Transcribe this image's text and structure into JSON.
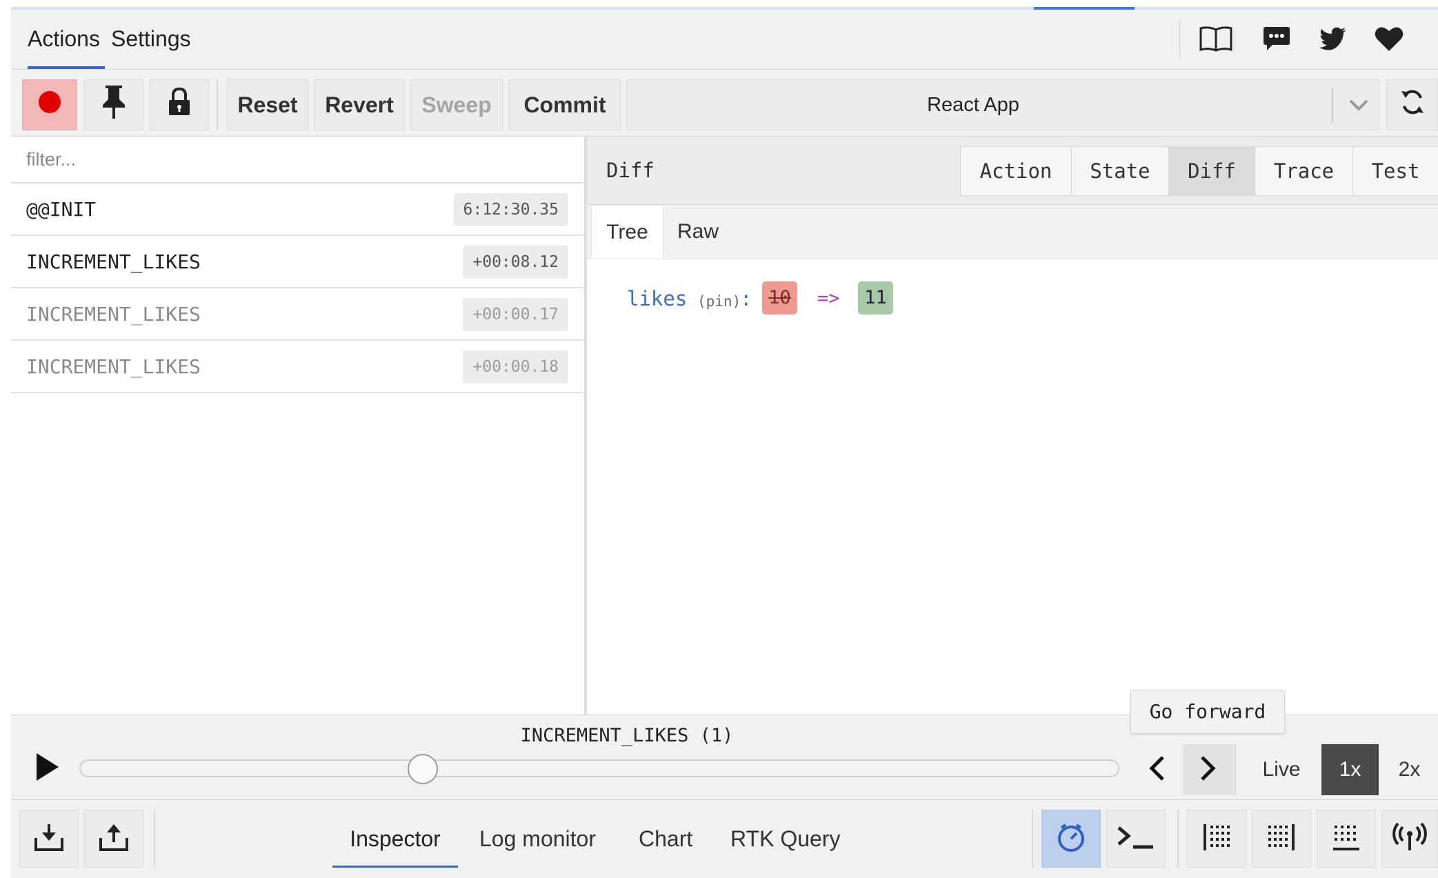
{
  "top_tabs": [
    {
      "label": "Actions",
      "active": true
    },
    {
      "label": "Settings",
      "active": false
    }
  ],
  "header_icons": [
    "book-icon",
    "chat-icon",
    "twitter-icon",
    "heart-icon"
  ],
  "toolbar": {
    "record_icon": "record-icon",
    "pin_icon": "pin-icon",
    "lock_icon": "lock-icon",
    "reset_label": "Reset",
    "revert_label": "Revert",
    "sweep_label": "Sweep",
    "commit_label": "Commit",
    "instance_label": "React App",
    "refresh_icon": "refresh-icon"
  },
  "filter": {
    "placeholder": "filter...",
    "value": ""
  },
  "actions": [
    {
      "name": "@@INIT",
      "time": "6:12:30.35",
      "skipped": false
    },
    {
      "name": "INCREMENT_LIKES",
      "time": "+00:08.12",
      "skipped": false
    },
    {
      "name": "INCREMENT_LIKES",
      "time": "+00:00.17",
      "skipped": true
    },
    {
      "name": "INCREMENT_LIKES",
      "time": "+00:00.18",
      "skipped": true
    }
  ],
  "detail": {
    "title": "Diff",
    "tabs": [
      {
        "label": "Action",
        "active": false
      },
      {
        "label": "State",
        "active": false
      },
      {
        "label": "Diff",
        "active": true
      },
      {
        "label": "Trace",
        "active": false
      },
      {
        "label": "Test",
        "active": false
      }
    ],
    "subtabs": [
      {
        "label": "Tree",
        "active": true
      },
      {
        "label": "Raw",
        "active": false
      }
    ],
    "diff": {
      "key": "likes",
      "pin": "(pin)",
      "colon": ":",
      "old": "10",
      "arrow": "=>",
      "new": "11"
    }
  },
  "slider": {
    "label": "INCREMENT_LIKES (1)",
    "position": 0.33,
    "tooltip": "Go forward",
    "speeds": [
      {
        "label": "Live",
        "active": false
      },
      {
        "label": "1x",
        "active": true
      },
      {
        "label": "2x",
        "active": false
      }
    ]
  },
  "monitors": [
    {
      "label": "Inspector",
      "active": true
    },
    {
      "label": "Log monitor",
      "active": false
    },
    {
      "label": "Chart",
      "active": false
    },
    {
      "label": "RTK Query",
      "active": false
    }
  ],
  "bottom_icons": [
    "import-icon",
    "export-icon",
    "dispatcher-icon",
    "terminal-icon",
    "dock-left-icon",
    "dock-right-icon",
    "dock-bottom-icon",
    "remote-icon"
  ]
}
